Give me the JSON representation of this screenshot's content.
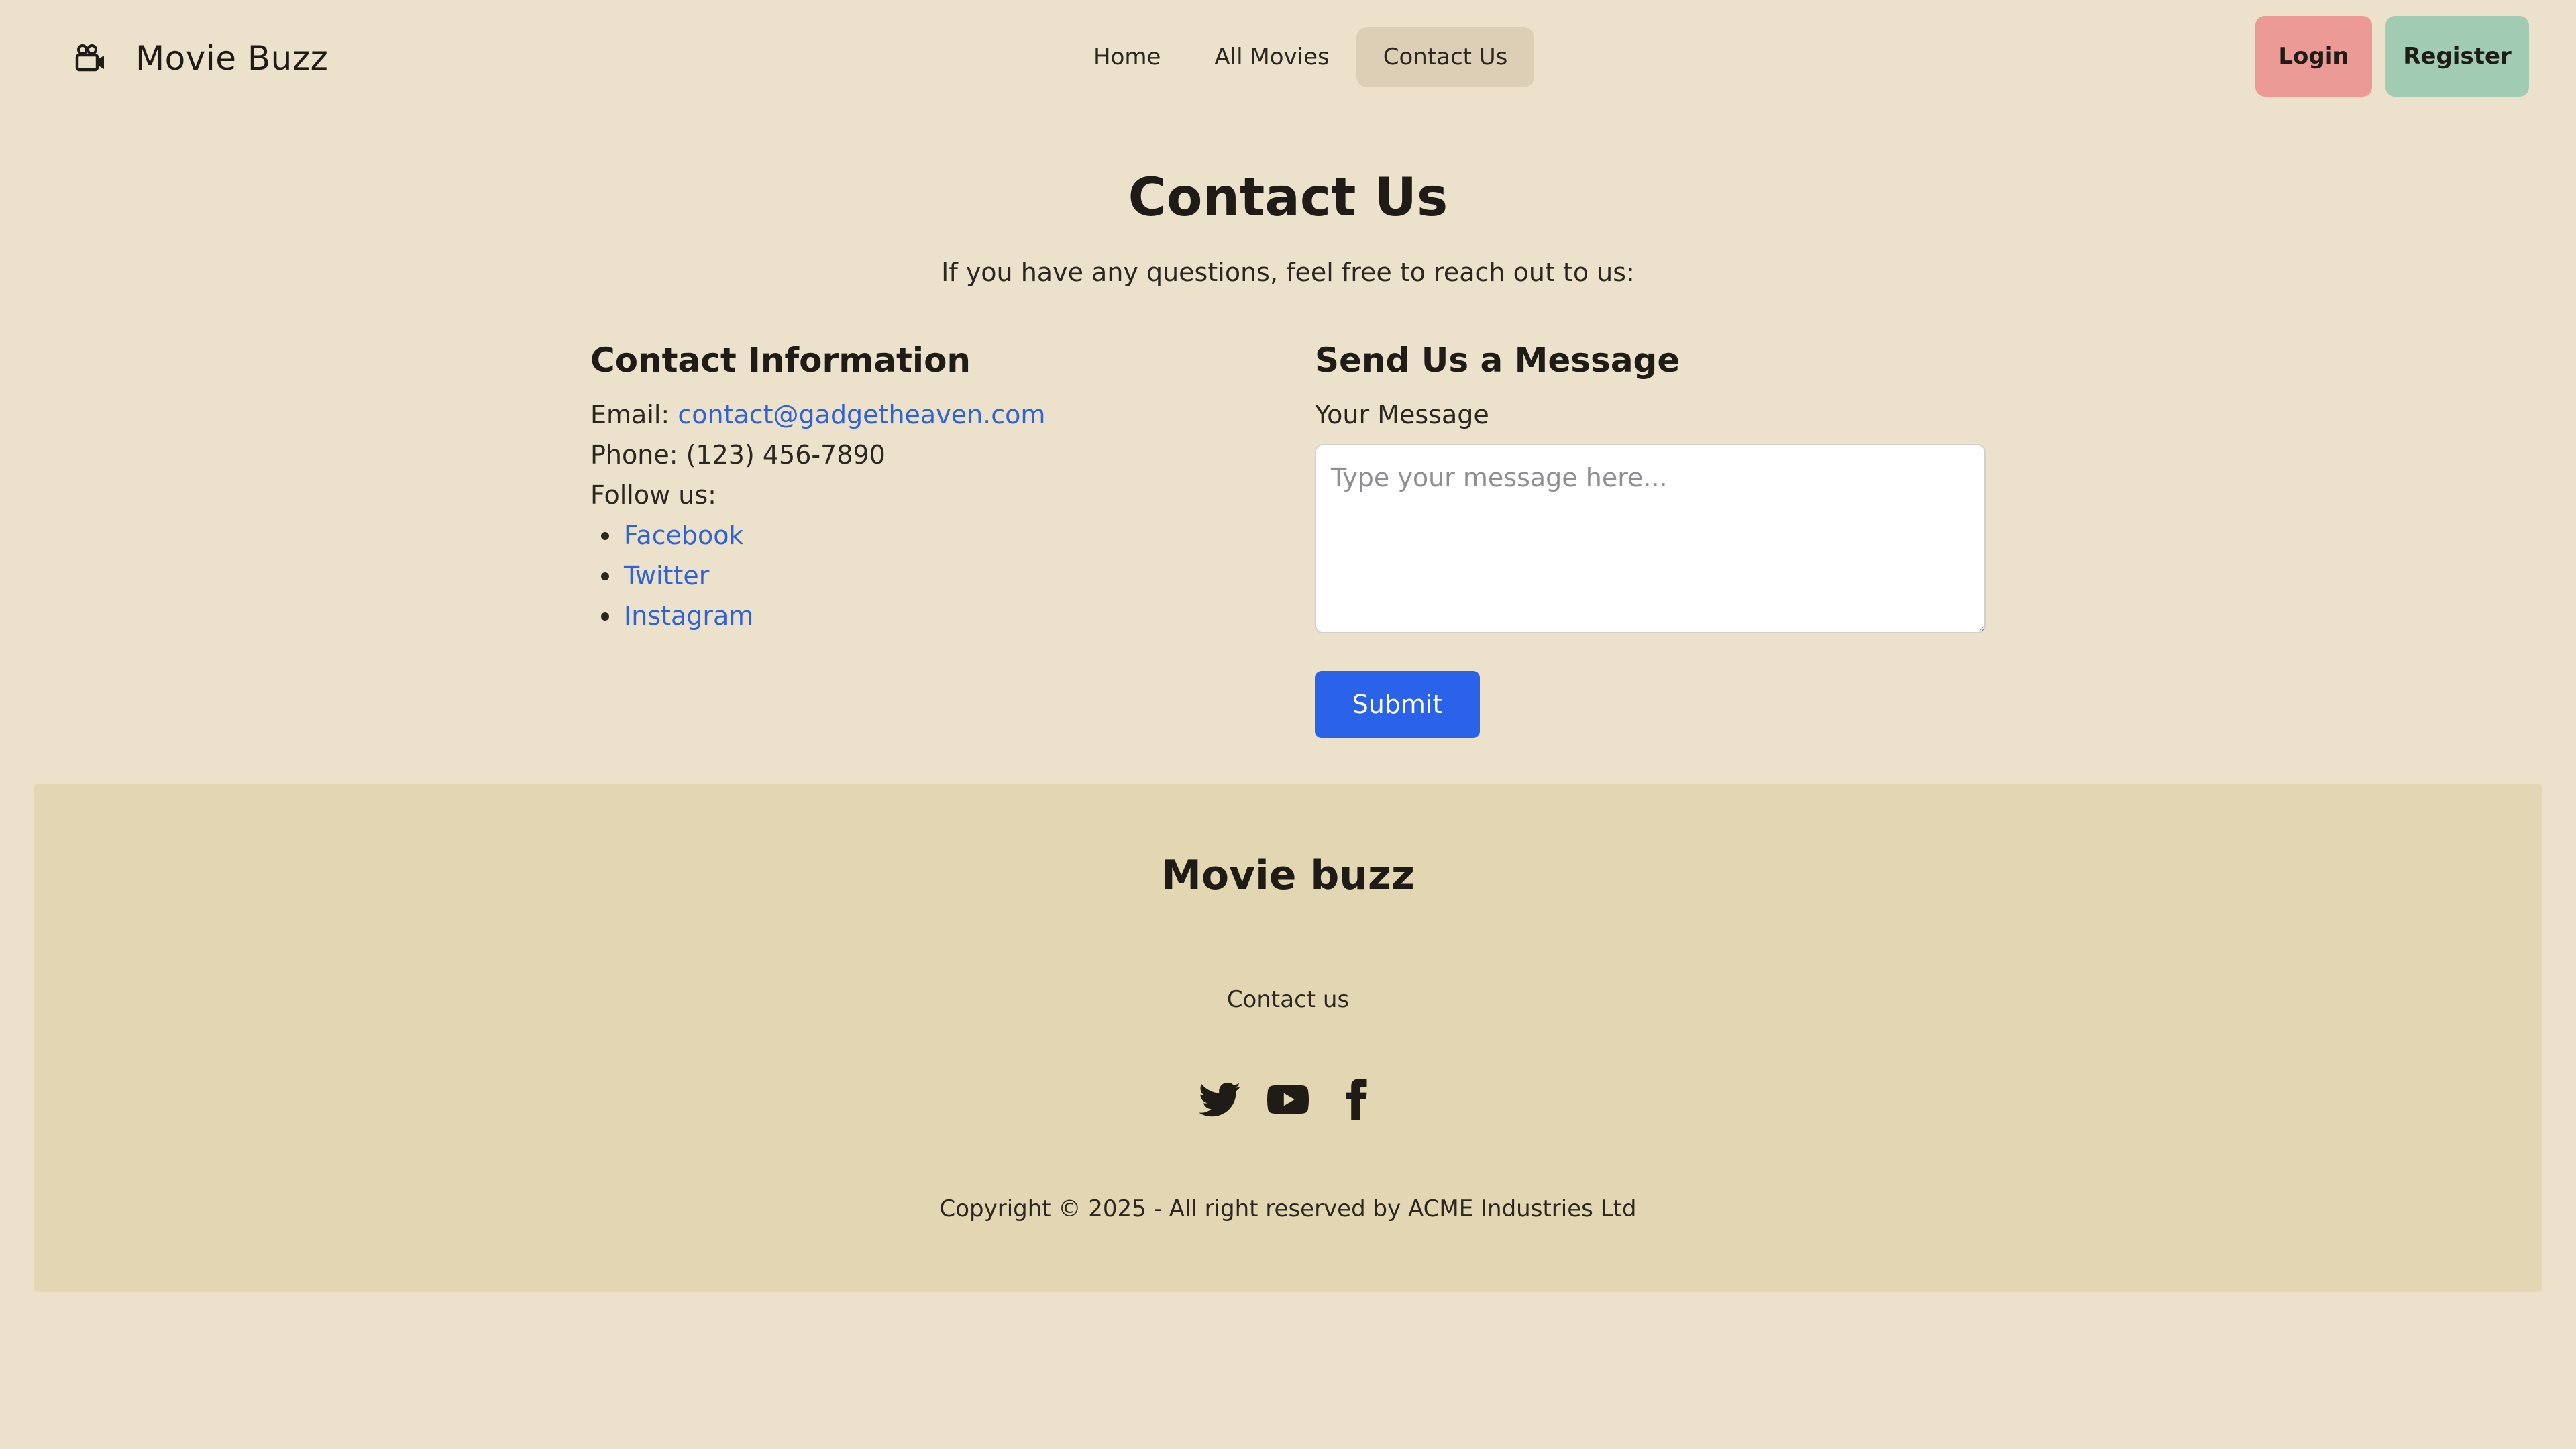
{
  "brand": {
    "name": "Movie Buzz",
    "icon": "camera-icon"
  },
  "nav": {
    "links": [
      {
        "label": "Home",
        "active": false
      },
      {
        "label": "All Movies",
        "active": false
      },
      {
        "label": "Contact Us",
        "active": true
      }
    ]
  },
  "auth": {
    "login_label": "Login",
    "register_label": "Register"
  },
  "main": {
    "title": "Contact Us",
    "subtitle": "If you have any questions, feel free to reach out to us:"
  },
  "contact_info": {
    "heading": "Contact Information",
    "email_label": "Email:",
    "email": "contact@gadgetheaven.com",
    "phone": "Phone: (123) 456-7890",
    "follow_label": "Follow us:",
    "social_links": [
      "Facebook",
      "Twitter",
      "Instagram"
    ]
  },
  "message_form": {
    "heading": "Send Us a Message",
    "field_label": "Your Message",
    "placeholder": "Type your message here...",
    "value": "",
    "submit_label": "Submit"
  },
  "footer": {
    "title": "Movie buzz",
    "link": "Contact us",
    "icons": [
      "twitter-icon",
      "youtube-icon",
      "facebook-icon"
    ],
    "copyright": "Copyright © 2025 - All right reserved by ACME Industries Ltd"
  },
  "colors": {
    "page_bg": "#ece2cb",
    "footer_bg": "#e3d7b3",
    "nav_active_bg": "#dccfb6",
    "login_bg": "#ec9a96",
    "register_bg": "#a2cbb3",
    "link": "#2f62d6",
    "submit_bg": "#2a63ea"
  }
}
